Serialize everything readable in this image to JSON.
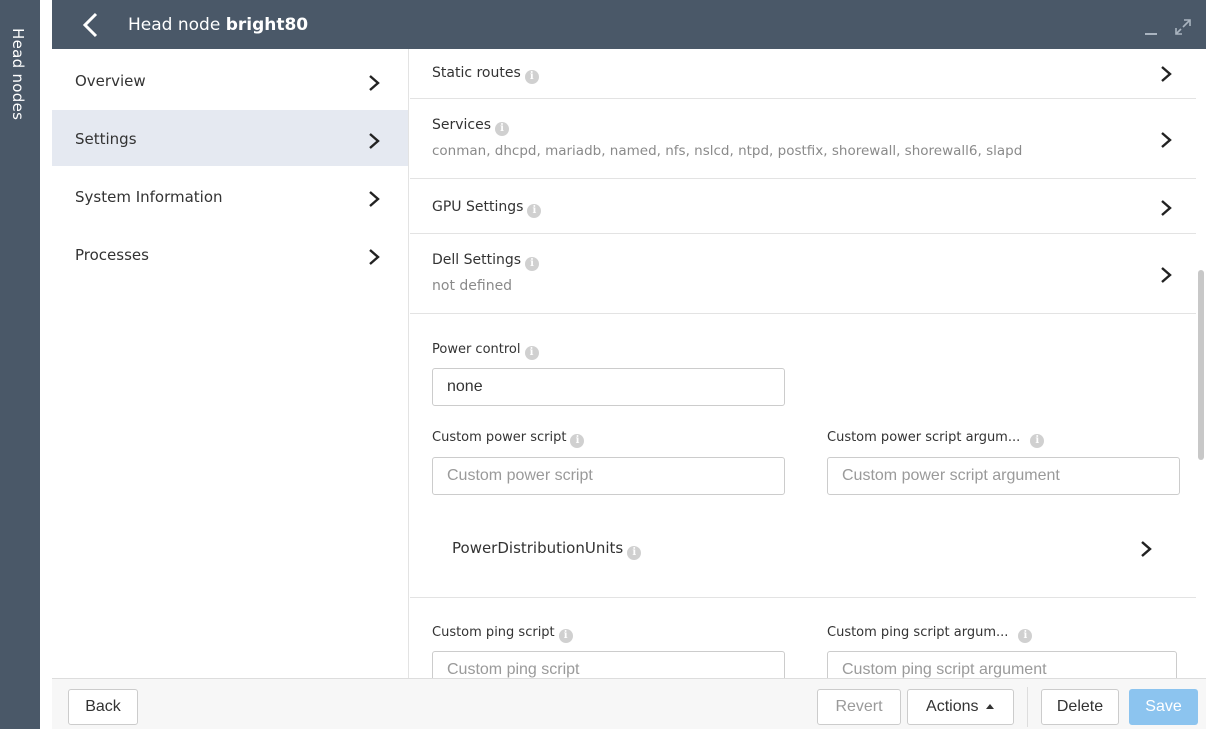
{
  "side_panel": {
    "label": "Head nodes"
  },
  "header": {
    "title_prefix": "Head node",
    "title_name": "bright80"
  },
  "nav": {
    "items": [
      {
        "label": "Overview",
        "active": false
      },
      {
        "label": "Settings",
        "active": true
      },
      {
        "label": "System Information",
        "active": false
      },
      {
        "label": "Processes",
        "active": false
      }
    ]
  },
  "content": {
    "static_routes": {
      "label": "Static routes"
    },
    "services": {
      "label": "Services",
      "value": "conman, dhcpd, mariadb, named, nfs, nslcd, ntpd, postfix, shorewall, shorewall6, slapd"
    },
    "gpu_settings": {
      "label": "GPU Settings"
    },
    "dell_settings": {
      "label": "Dell Settings",
      "value": "not defined"
    },
    "power_control": {
      "label": "Power control",
      "value": "none"
    },
    "custom_power_script": {
      "label": "Custom power script",
      "placeholder": "Custom power script"
    },
    "custom_power_script_argument": {
      "label": "Custom power script argum...",
      "placeholder": "Custom power script argument"
    },
    "power_distribution_units": {
      "label": "PowerDistributionUnits"
    },
    "custom_ping_script": {
      "label": "Custom ping script",
      "placeholder": "Custom ping script"
    },
    "custom_ping_script_argument": {
      "label": "Custom ping script argum...",
      "placeholder": "Custom ping script argument"
    }
  },
  "footer": {
    "back": "Back",
    "revert": "Revert",
    "actions": "Actions",
    "delete": "Delete",
    "save": "Save"
  },
  "colors": {
    "header_bg": "#4a5868",
    "nav_active_bg": "#e5e9f1",
    "save_bg": "#8cc4ef"
  },
  "icons": [
    "back-chevron-icon",
    "chevron-right-icon",
    "info-icon",
    "minimize-icon",
    "maximize-icon",
    "caret-up-icon"
  ]
}
